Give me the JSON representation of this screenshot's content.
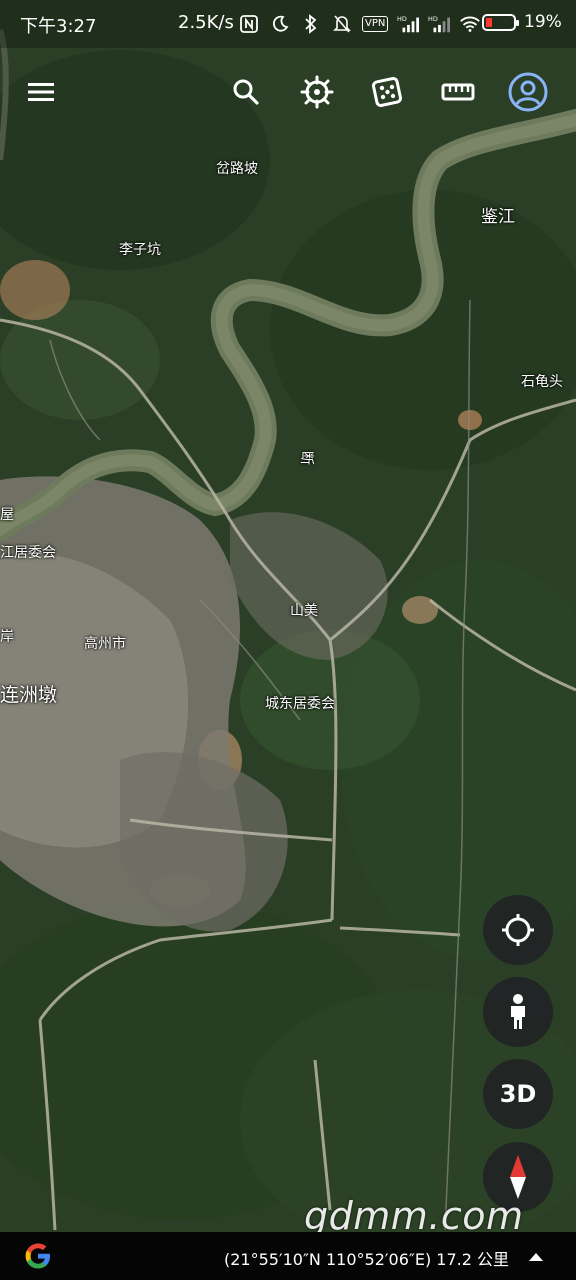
{
  "status_bar": {
    "time": "下午3:27",
    "net_speed": "2.5K/s",
    "vpn": "VPN",
    "battery": "19%",
    "battery_level": 0.19
  },
  "toolbar": {
    "icons": [
      "menu-icon",
      "search-icon",
      "voyager-icon",
      "random-dice-icon",
      "ruler-icon",
      "account-icon"
    ]
  },
  "map_labels": {
    "cha_lu_po": "岔路坡",
    "jian_jiang": "鉴江",
    "li_zi_keng": "李子坑",
    "shi_gui_tou": "石龟头",
    "wu": "屋",
    "jiang_jwh": "江居委会",
    "duan": "断",
    "shan_mei": "山美",
    "an": "岸",
    "gaozhou": "高州市",
    "lianzhoudun": "连洲墩",
    "chengdong": "城东居委会"
  },
  "fabs": {
    "three_d": "3D"
  },
  "watermark": "gdmm.com",
  "bottom_bar": {
    "coordinates": "(21°55′10″N 110°52′06″E) 17.2 公里"
  },
  "colors": {
    "battery_low": "#ff3b30",
    "compass_red": "#e53935",
    "google_blue": "#4285F4",
    "google_red": "#EA4335",
    "google_yellow": "#FBBC05",
    "google_green": "#34A853",
    "account_blue": "#8ab4f8"
  }
}
